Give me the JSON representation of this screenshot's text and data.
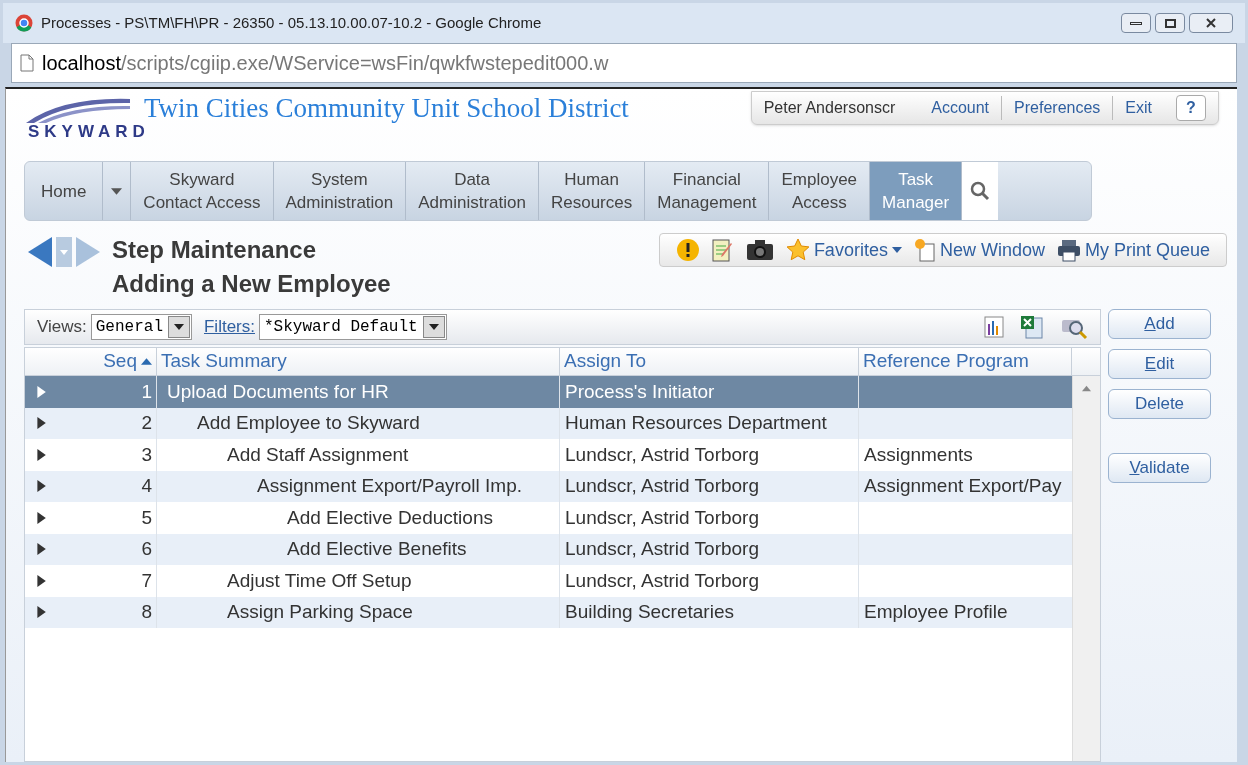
{
  "window": {
    "title": "Processes - PS\\TM\\FH\\PR - 26350 - 05.13.10.00.07-10.2 - Google Chrome"
  },
  "address_bar": {
    "host": "localhost",
    "path": "/scripts/cgiip.exe/WService=wsFin/qwkfwstepedit000.w"
  },
  "header": {
    "logo_text": "SKYWARD",
    "district": "Twin Cities Community Unit School District",
    "user": "Peter Andersonscr",
    "links": [
      "Account",
      "Preferences",
      "Exit"
    ],
    "help": "?"
  },
  "nav": {
    "home": "Home",
    "tabs": [
      {
        "lines": [
          "Skyward",
          "Contact Access"
        ],
        "selected": false
      },
      {
        "lines": [
          "System",
          "Administration"
        ],
        "selected": false
      },
      {
        "lines": [
          "Data",
          "Administration"
        ],
        "selected": false
      },
      {
        "lines": [
          "Human",
          "Resources"
        ],
        "selected": false
      },
      {
        "lines": [
          "Financial",
          "Management"
        ],
        "selected": false
      },
      {
        "lines": [
          "Employee",
          "Access"
        ],
        "selected": false
      },
      {
        "lines": [
          "Task",
          "Manager"
        ],
        "selected": true
      }
    ]
  },
  "page_title": [
    "Step Maintenance",
    "Adding a New Employee"
  ],
  "toolbar": {
    "favorites": "Favorites",
    "new_window": "New Window",
    "print_queue": "My Print Queue"
  },
  "filters": {
    "views_label": "Views:",
    "view": "General",
    "filters_label": "Filters:",
    "filter": "*Skyward Default"
  },
  "table": {
    "columns": [
      "Seq",
      "Task Summary",
      "Assign To",
      "Reference Program"
    ],
    "rows": [
      {
        "seq": "1",
        "summary": "Upload Documents for HR",
        "assign_to": "Process's Initiator",
        "selected": true,
        "children": [
          {
            "seq": "2",
            "summary": "Add Employee to Skyward",
            "assign_to": "Human Resources Department",
            "selected": false,
            "children": [
              {
                "seq": "3",
                "summary": "Add Staff Assignment",
                "assign_to": "Lundscr, Astrid Torborg",
                "reference": "Assignments",
                "selected": false,
                "children": [
                  {
                    "seq": "4",
                    "summary": "Assignment Export/Payroll Imp.",
                    "assign_to": "Lundscr, Astrid Torborg",
                    "reference": "Assignment Export/Pay",
                    "selected": false,
                    "children": [
                      {
                        "seq": "5",
                        "summary": "Add Elective Deductions",
                        "assign_to": "Lundscr, Astrid Torborg",
                        "selected": false
                      },
                      {
                        "seq": "6",
                        "summary": "Add Elective Benefits",
                        "assign_to": "Lundscr, Astrid Torborg",
                        "selected": false
                      }
                    ]
                  }
                ]
              },
              {
                "seq": "7",
                "summary": "Adjust Time Off Setup",
                "assign_to": "Lundscr, Astrid Torborg",
                "selected": false
              },
              {
                "seq": "8",
                "summary": "Assign Parking Space",
                "assign_to": "Building Secretaries",
                "reference": "Employee Profile",
                "selected": false
              }
            ]
          }
        ]
      }
    ]
  },
  "actions": [
    {
      "parts": [
        {
          "text": "A",
          "underlined": true
        },
        {
          "text": "dd",
          "underlined": false
        }
      ]
    },
    {
      "parts": [
        {
          "text": "E",
          "underlined": true
        },
        {
          "text": "dit",
          "underlined": false
        }
      ]
    },
    {
      "parts": [
        {
          "text": "Delete",
          "underlined": false
        }
      ]
    },
    {
      "parts": [
        {
          "text": "V",
          "underlined": true
        },
        {
          "text": "alidate",
          "underlined": false
        }
      ]
    }
  ]
}
